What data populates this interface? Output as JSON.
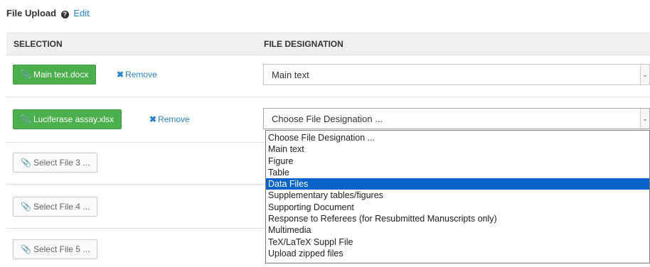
{
  "header": {
    "title": "File Upload",
    "help_icon": "question-circle-icon",
    "edit_label": "Edit"
  },
  "table": {
    "col_selection": "SELECTION",
    "col_designation": "FILE DESIGNATION"
  },
  "rows": [
    {
      "file_button": "Main text.docx",
      "remove_label": "Remove",
      "designation": "Main text"
    },
    {
      "file_button": "Luciferase assay.xlsx",
      "remove_label": "Remove",
      "designation": "Choose File Designation ..."
    },
    {
      "file_button": "Select File 3 ..."
    },
    {
      "file_button": "Select File 4 ..."
    },
    {
      "file_button": "Select File 5 ..."
    }
  ],
  "dropdown": {
    "options": [
      "Choose File Designation ...",
      "Main text",
      "Figure",
      "Table",
      "Data Files",
      "Supplementary tables/figures",
      "Supporting Document",
      "Response to Referees (for Resubmitted Manuscripts only)",
      "Multimedia",
      "TeX/LaTeX Suppl File",
      "Upload zipped files"
    ],
    "highlighted": "Data Files"
  },
  "colors": {
    "green": "#4cae4c",
    "link": "#2a7fc4",
    "highlight": "#0a63c9"
  }
}
